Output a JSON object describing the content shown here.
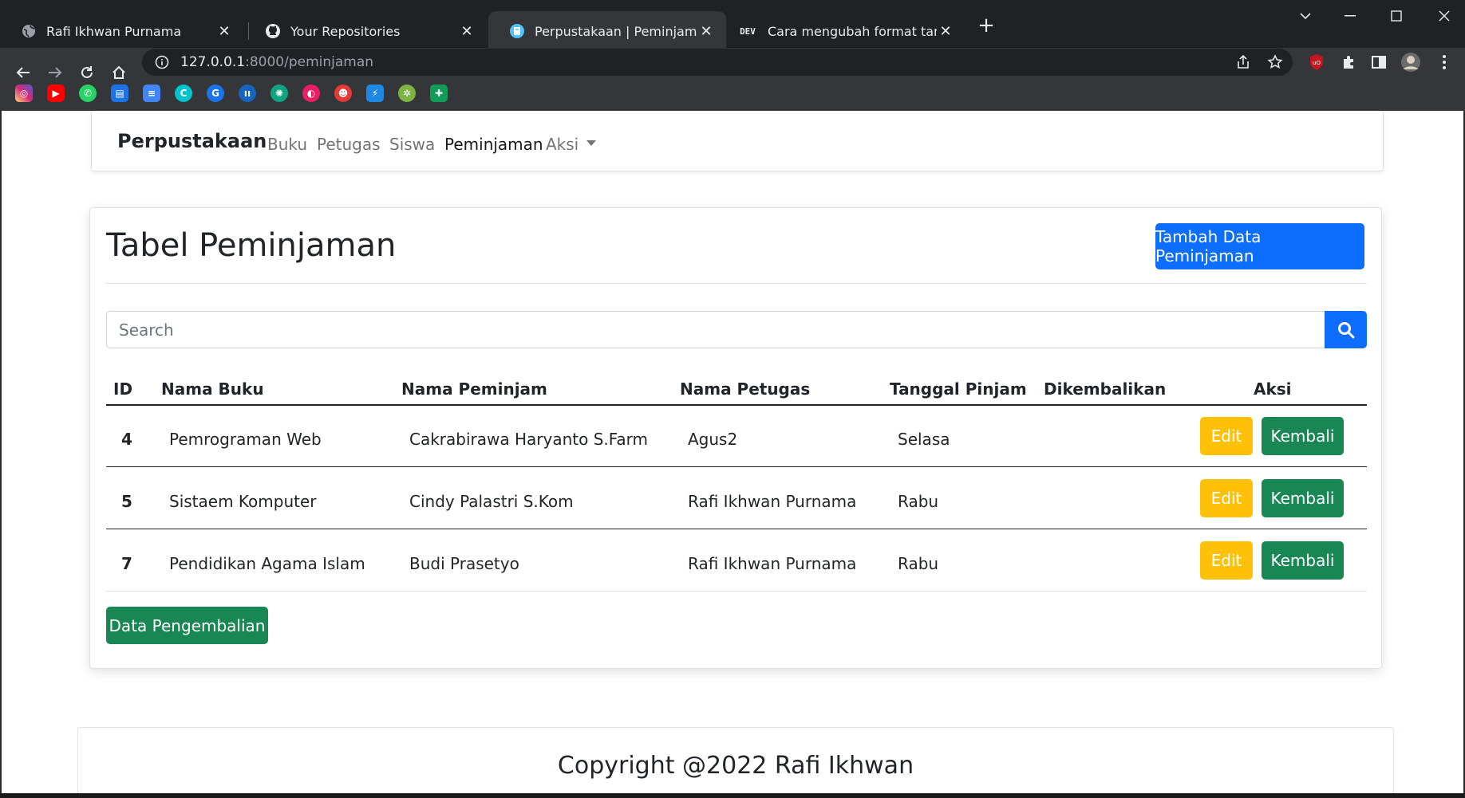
{
  "browser": {
    "tabs": [
      {
        "title": "Rafi Ikhwan Purnama",
        "icon": "globe-icon"
      },
      {
        "title": "Your Repositories",
        "icon": "github-icon"
      },
      {
        "title": "Perpustakaan | Peminjaman",
        "icon": "site-icon"
      },
      {
        "title": "Cara mengubah format tanggal n",
        "icon": "dev-icon",
        "badge": "DEV"
      }
    ],
    "url_host": "127.0.0.1",
    "url_path": ":8000/peminjaman"
  },
  "navbar": {
    "brand": "Perpustakaan",
    "links": [
      "Buku",
      "Petugas",
      "Siswa",
      "Peminjaman",
      "Aksi"
    ],
    "active": "Peminjaman"
  },
  "card": {
    "title": "Tabel Peminjaman",
    "add_button": "Tambah Data Peminjaman",
    "search_placeholder": "Search",
    "return_data_button": "Data Pengembalian"
  },
  "table": {
    "headers": [
      "ID",
      "Nama Buku",
      "Nama Peminjam",
      "Nama Petugas",
      "Tanggal Pinjam",
      "Dikembalikan",
      "Aksi"
    ],
    "rows": [
      {
        "id": "4",
        "buku": "Pemrograman Web",
        "peminjam": "Cakrabirawa Haryanto S.Farm",
        "petugas": "Agus2",
        "tanggal": "Selasa",
        "dikembalikan": "",
        "edit": "Edit",
        "kembali": "Kembali"
      },
      {
        "id": "5",
        "buku": "Sistaem Komputer",
        "peminjam": "Cindy Palastri S.Kom",
        "petugas": "Rafi Ikhwan Purnama",
        "tanggal": "Rabu",
        "dikembalikan": "",
        "edit": "Edit",
        "kembali": "Kembali"
      },
      {
        "id": "7",
        "buku": "Pendidikan Agama Islam",
        "peminjam": "Budi Prasetyo",
        "petugas": "Rafi Ikhwan Purnama",
        "tanggal": "Rabu",
        "dikembalikan": "",
        "edit": "Edit",
        "kembali": "Kembali"
      }
    ]
  },
  "footer": {
    "text": "Copyright @2022 Rafi Ikhwan"
  },
  "colors": {
    "primary": "#0d6efd",
    "success": "#198754",
    "warning": "#ffc107"
  }
}
